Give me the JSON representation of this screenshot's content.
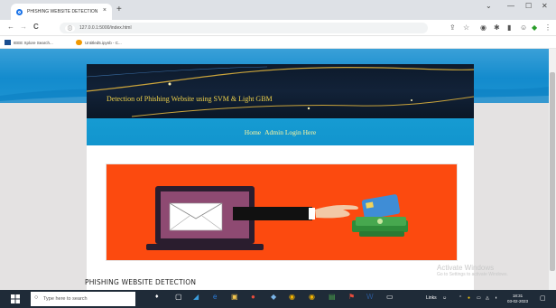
{
  "browser": {
    "tab_title": "PHISHING WEBSITE DETECTION",
    "tab_close": "×",
    "new_tab": "+",
    "url": "127.0.0.1:5000/index.html",
    "site_chip": "ⓘ",
    "win_minimize": "—",
    "win_restore": "☐",
    "win_close": "✕",
    "win_chevron": "⌄",
    "back": "←",
    "forward": "→",
    "reload": "C"
  },
  "bookmarks": [
    {
      "label": "IEEE Xplore Search...",
      "color": "#1a4d8f"
    },
    {
      "label": "Untitled5.ipynb - C...",
      "color": "#f29900"
    }
  ],
  "page": {
    "banner_title": "Detection of Phishing Website using SVM & Light GBM",
    "menu": [
      {
        "label": "Home"
      },
      {
        "label": "Admin Login Here"
      }
    ],
    "caption": "PHISHING WEBSITE DETECTION"
  },
  "watermark": {
    "line1": "Activate Windows",
    "line2": "Go to Settings to activate Windows."
  },
  "taskbar": {
    "search_placeholder": "Type here to search",
    "links_label": "Links",
    "time": "18:31",
    "date": "03-02-2023"
  },
  "colors": {
    "accent_blue": "#1295ce",
    "banner_title": "#f0d24a",
    "hero_bg": "#fc4a0f"
  }
}
